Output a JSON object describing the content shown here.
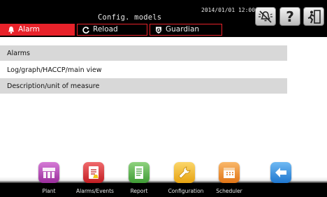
{
  "header": {
    "title": "Config. models",
    "datetime": "2014/01/01  12:00",
    "tabs": [
      {
        "label": "Alarm",
        "icon": "bell-icon"
      },
      {
        "label": "Reload",
        "icon": "reload-icon"
      },
      {
        "label": "Guardian",
        "icon": "guardian-icon"
      }
    ],
    "buttons": [
      {
        "icon": "alarm-bell-off-icon"
      },
      {
        "icon": "help-icon",
        "label": "?"
      },
      {
        "icon": "exit-icon"
      }
    ]
  },
  "menu": {
    "items": [
      {
        "label": "Alarms"
      },
      {
        "label": "Log/graph/HACCP/main view"
      },
      {
        "label": "Description/unit of measure"
      }
    ]
  },
  "nav": {
    "items": [
      {
        "label": "Plant",
        "icon": "plant-icon",
        "color": "#b53fb6"
      },
      {
        "label": "Alarms/Events",
        "icon": "alarms-events-icon",
        "color": "#d8282c"
      },
      {
        "label": "Report",
        "icon": "report-icon",
        "color": "#4aa43e"
      },
      {
        "label": "Configuration",
        "icon": "wrench-icon",
        "color": "#f3b11a"
      },
      {
        "label": "Scheduler",
        "icon": "calendar-icon",
        "color": "#f08a1c"
      },
      {
        "label": "",
        "icon": "back-arrow-icon",
        "color": "#2c8fe0"
      }
    ]
  },
  "colors": {
    "accent": "#e8222a",
    "header_bg": "#000000",
    "row_shade": "#d8d8d8"
  }
}
